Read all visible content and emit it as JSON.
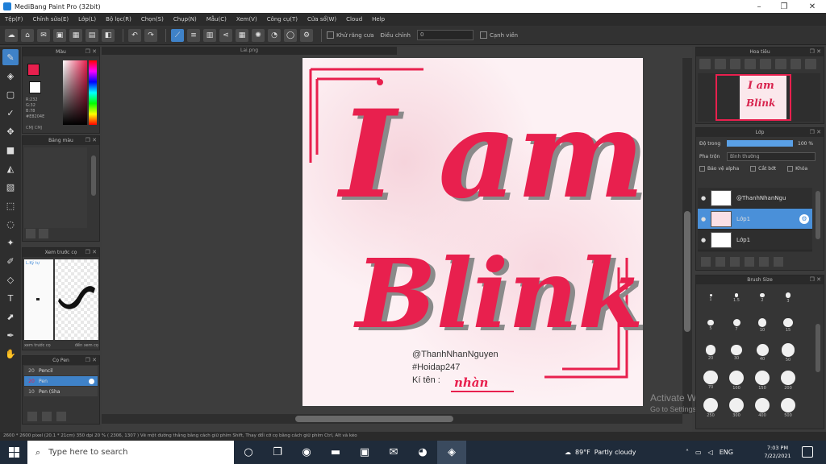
{
  "window": {
    "title": "MediBang Paint Pro (32bit)",
    "controls": [
      "–",
      "❐",
      "✕"
    ]
  },
  "menu": [
    "Tệp(F)",
    "Chỉnh sửa(E)",
    "Lớp(L)",
    "Bộ lọc(R)",
    "Chọn(S)",
    "Chụp(N)",
    "Mẫu(C)",
    "Xem(V)",
    "Công cụ(T)",
    "Cửa sổ(W)",
    "Cloud",
    "Help"
  ],
  "toolbar": {
    "check_label": "Khử răng cưa",
    "correction_label": "Điều chỉnh",
    "correction_value": "0",
    "snap_label": "Cạnh viền"
  },
  "canvas": {
    "tab_title": "Lai.png",
    "art_line1": "@ThanhNhanNguyen",
    "art_line2": "#Hoidap247",
    "art_line3": "Kí tên :",
    "signature": "nhàn"
  },
  "panels": {
    "color_title": "Màu",
    "color_info": [
      "R:232",
      "G:32",
      "B:78",
      "#E8204E"
    ],
    "color_footer": "CMJ  CMJ",
    "palette_title": "Bảng màu",
    "brush_preview_title": "Xem trước cọ",
    "brush_preview_label": "L.Ký tự",
    "brush_preview_foot_left": "xem trước cọ",
    "brush_preview_foot_right": "đến xem cọ",
    "brush_title": "Cọ Pen",
    "navigator_title": "Hoa tiêu",
    "layer_title": "Lớp",
    "opacity_label": "Độ trong",
    "opacity_value": "100 %",
    "opacity_fraction": 1.0,
    "blend_label": "Pha trộn",
    "blend_value": "Bình thường",
    "check_alpha": "Bảo vệ alpha",
    "check_clip": "Cắt bớt",
    "check_lock": "Khóa",
    "brushsize_title": "Brush Size"
  },
  "brushes": [
    {
      "size": "20",
      "name": "Pencil",
      "active": false
    },
    {
      "size": "20",
      "name": "Pen",
      "active": true
    },
    {
      "size": "10",
      "name": "Pen (Sha",
      "active": false
    }
  ],
  "layers": [
    {
      "name": "@ThanhNhanNgu",
      "active": false
    },
    {
      "name": "Lớp1",
      "active": true
    },
    {
      "name": "Lớp1",
      "active": false
    }
  ],
  "brush_sizes": [
    "1",
    "1.5",
    "2",
    "3",
    "5",
    "7",
    "10",
    "15",
    "20",
    "30",
    "40",
    "50",
    "70",
    "100",
    "150",
    "200",
    "250",
    "300",
    "400",
    "500"
  ],
  "statusbar": "2600 * 2600 pixel  (20.1 * 21cm)  350 dpi  20 %  ( 2306, 1307 )  Vẽ một đường thẳng bằng cách giữ phím Shift, Thay đổi cỡ cọ bằng cách giữ phím Ctrl, Alt và kéo",
  "watermark": {
    "line1": "Activate Windows",
    "line2": "Go to Settings to activate Windows."
  },
  "taskbar": {
    "search_placeholder": "Type here to search",
    "weather_temp": "89°F",
    "weather_desc": "Partly cloudy",
    "lang": "ENG",
    "time": "7:03 PM",
    "date": "7/22/2021"
  },
  "art_colors": {
    "primary": "#e8204e",
    "shadow": "#8a8a8a"
  }
}
